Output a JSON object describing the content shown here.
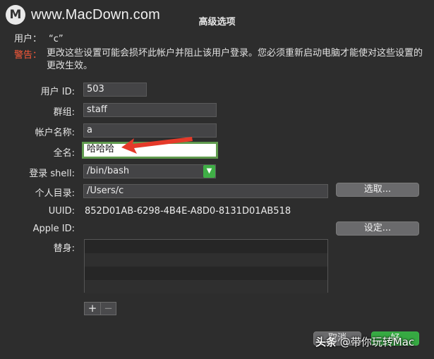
{
  "watermark": {
    "logo_letter": "M",
    "site": "www.MacDown.com"
  },
  "dialog": {
    "title": "高级选项",
    "user_label": "用户：",
    "user_value": "“c”",
    "warning_label": "警告：",
    "warning_text": "更改这些设置可能会损坏此帐户并阻止该用户登录。您必须重新启动电脑才能使对这些设置的更改生效。"
  },
  "form": {
    "user_id": {
      "label": "用户 ID:",
      "value": "503"
    },
    "group": {
      "label": "群组:",
      "value": "staff"
    },
    "account_name": {
      "label": "帐户名称:",
      "value": "a"
    },
    "full_name": {
      "label": "全名:",
      "value": "哈哈哈"
    },
    "login_shell": {
      "label": "登录 shell:",
      "value": "/bin/bash"
    },
    "home_dir": {
      "label": "个人目录:",
      "value": "/Users/c",
      "button": "选取..."
    },
    "uuid": {
      "label": "UUID:",
      "value": "852D01AB-6298-4B4E-A8D0-8131D01AB518"
    },
    "apple_id": {
      "label": "Apple ID:",
      "button": "设定..."
    },
    "aliases": {
      "label": "替身:"
    }
  },
  "buttons": {
    "add": "+",
    "remove": "−",
    "cancel": "取消",
    "ok": "好"
  },
  "caption": {
    "source": "头条",
    "author": "@带你玩转Mac"
  },
  "colors": {
    "accent_green": "#36a942",
    "focus_ring": "#5f9a4e",
    "warning_red": "#ff5a3a",
    "annotation_arrow": "#e53a2a"
  }
}
